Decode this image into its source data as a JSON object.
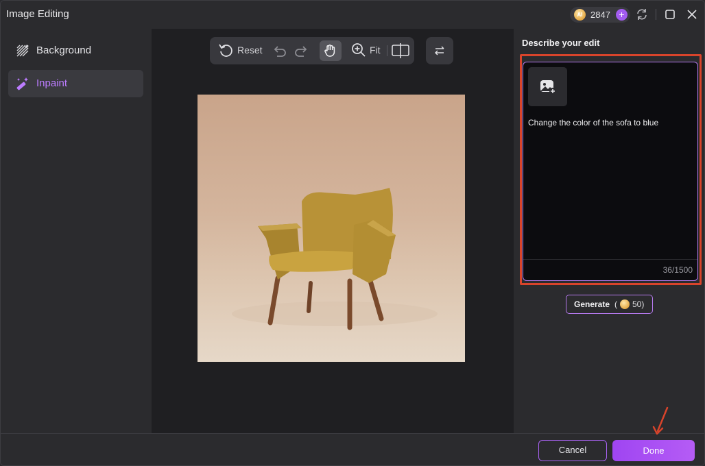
{
  "window": {
    "title": "Image Editing"
  },
  "credits": {
    "coin_label": "AI",
    "count": "2847",
    "plus": "+"
  },
  "sidebar": {
    "items": [
      {
        "label": "Background",
        "icon": "background-pattern-icon",
        "active": false
      },
      {
        "label": "Inpaint",
        "icon": "magic-wand-icon",
        "active": true
      }
    ]
  },
  "toolbar": {
    "reset_label": "Reset",
    "fit_label": "Fit"
  },
  "canvas": {
    "image_subject": "mustard armchair photo"
  },
  "panel": {
    "title": "Describe your edit",
    "prompt_text": "Change the color of the sofa to blue",
    "char_count": "36/1500",
    "generate_label": "Generate",
    "generate_open": "(",
    "generate_cost": "50)"
  },
  "footer": {
    "cancel_label": "Cancel",
    "done_label": "Done"
  },
  "colors": {
    "accent": "#a862f2",
    "highlight": "#d9442b",
    "canvas_bg": "#1f1f22"
  }
}
